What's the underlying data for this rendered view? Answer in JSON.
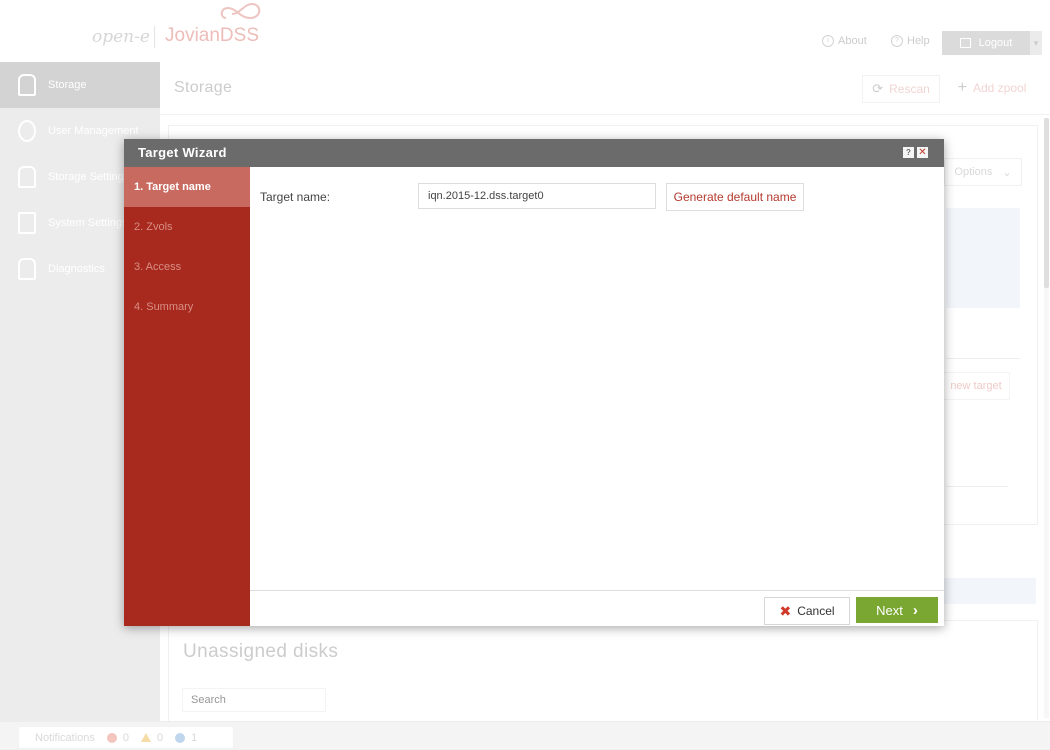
{
  "brand": {
    "maker": "open-e",
    "product": "JovianDSS"
  },
  "topbar": {
    "about_label": "About",
    "help_label": "Help",
    "logout_label": "Logout"
  },
  "sidebar": {
    "items": [
      {
        "label": "Storage"
      },
      {
        "label": "User Management"
      },
      {
        "label": "Storage Settings"
      },
      {
        "label": "System Settings"
      },
      {
        "label": "Diagnostics"
      }
    ]
  },
  "page": {
    "title": "Storage",
    "rescan_label": "Rescan",
    "add_zpool_label": "Add zpool",
    "options_label": "Options",
    "new_target_label": "new target"
  },
  "unassigned": {
    "title": "Unassigned disks",
    "search_placeholder": "Search"
  },
  "footer": {
    "notifications_label": "Notifications",
    "errors": "0",
    "warnings": "0",
    "info": "1"
  },
  "wizard": {
    "title": "Target Wizard",
    "steps": [
      {
        "label": "1. Target name"
      },
      {
        "label": "2. Zvols"
      },
      {
        "label": "3. Access"
      },
      {
        "label": "4. Summary"
      }
    ],
    "field_label": "Target name:",
    "field_value": "iqn.2015-12.dss.target0",
    "generate_label": "Generate default name",
    "cancel_label": "Cancel",
    "next_label": "Next"
  },
  "colors": {
    "accent": "#a8291d",
    "next": "#7aa632",
    "header": "#6b6b6b"
  }
}
